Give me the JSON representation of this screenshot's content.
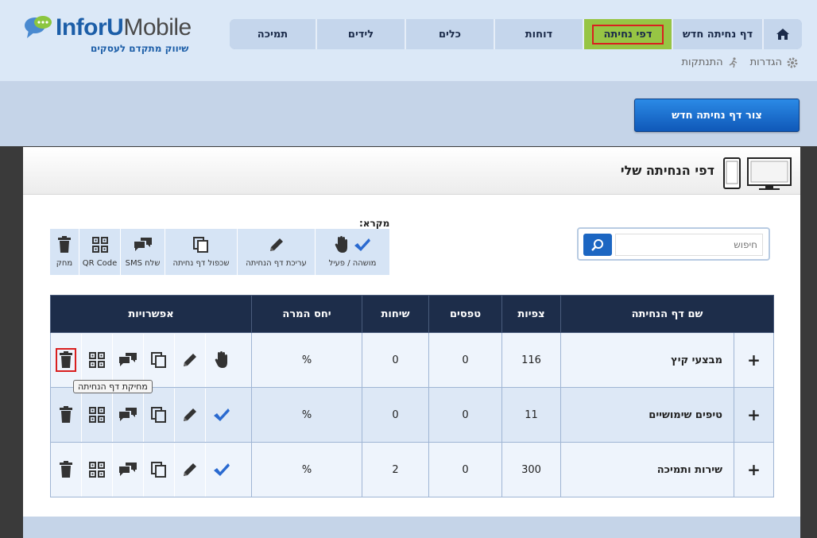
{
  "logo": {
    "brand_part1": "InforU",
    "brand_part2": "Mobile",
    "tagline": "שיווק מתקדם לעסקים"
  },
  "nav": {
    "tabs": [
      {
        "label": "תמיכה"
      },
      {
        "label": "לידים"
      },
      {
        "label": "כלים"
      },
      {
        "label": "דוחות"
      },
      {
        "label": "דפי נחיתה",
        "active": true
      },
      {
        "label": "דף נחיתה חדש"
      }
    ]
  },
  "utility": {
    "settings": "הגדרות",
    "logout": "התנתקות"
  },
  "create_button": "צור דף נחיתה חדש",
  "panel": {
    "title": "דפי הנחיתה שלי"
  },
  "search": {
    "placeholder": "חיפוש"
  },
  "legend": {
    "title": "מקרא:",
    "items": [
      {
        "label": "מחק",
        "icon": "trash-icon"
      },
      {
        "label": "QR Code",
        "icon": "qr-icon"
      },
      {
        "label": "שלח SMS",
        "icon": "sms-icon"
      },
      {
        "label": "שכפול דף נחיתה",
        "icon": "duplicate-icon"
      },
      {
        "label": "עריכת דף הנחיתה",
        "icon": "pencil-icon"
      },
      {
        "label": "מושהה / פעיל",
        "icon": "pause-active-icon"
      }
    ]
  },
  "table": {
    "headers": {
      "name": "שם דף הנחיתה",
      "views": "צפיות",
      "forms": "טפסים",
      "calls": "שיחות",
      "conversion": "יחס המרה",
      "options": "אפשרויות"
    },
    "rows": [
      {
        "name": "מבצעי קיץ",
        "views": "116",
        "forms": "0",
        "calls": "0",
        "conversion": "%",
        "status": "paused"
      },
      {
        "name": "טיפים שימושיים",
        "views": "11",
        "forms": "0",
        "calls": "0",
        "conversion": "%",
        "status": "active"
      },
      {
        "name": "שירות ותמיכה",
        "views": "300",
        "forms": "0",
        "calls": "2",
        "conversion": "%",
        "status": "active"
      }
    ],
    "tooltip": "מחיקת דף הנחיתה"
  },
  "colors": {
    "nav_active": "#97c544",
    "header_dark": "#1d2d4a",
    "button_blue": "#1c66c2",
    "highlight_red": "#d91f1f"
  }
}
